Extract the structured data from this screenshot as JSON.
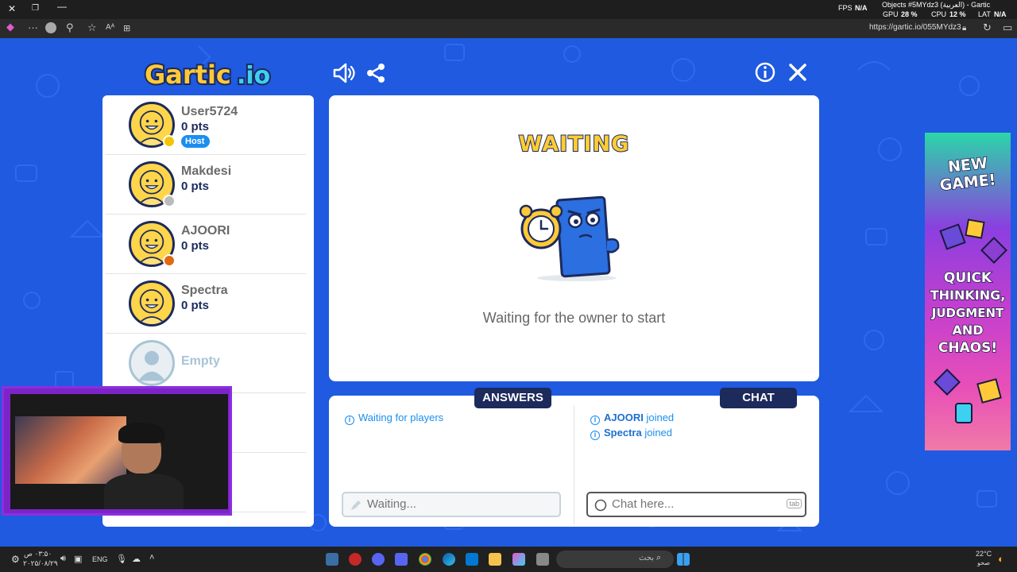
{
  "titlebar": {
    "fps_label": "FPS",
    "fps_value": "N/A",
    "gpu_label": "GPU",
    "gpu_value": "28 %",
    "cpu_label": "CPU",
    "cpu_value": "12 %",
    "lat_label": "LAT",
    "lat_value": "N/A",
    "tab_title": "Objects #5MYdz3 (العربية) - Gartic"
  },
  "browser": {
    "url": "https://gartic.io/055MYdz3"
  },
  "game": {
    "logo_text": "Gartic.io",
    "players": [
      {
        "name": "User5724",
        "pts": "0 pts",
        "host": true,
        "host_label": "Host",
        "dot": "#f5c400"
      },
      {
        "name": "Makdesi",
        "pts": "0 pts",
        "host": false,
        "dot": "#bbbbbb"
      },
      {
        "name": "AJOORI",
        "pts": "0 pts",
        "host": false,
        "dot": "#e06a10"
      },
      {
        "name": "Spectra",
        "pts": "0 pts",
        "host": false,
        "dot": ""
      },
      {
        "name": "Empty",
        "pts": "",
        "host": false,
        "dot": ""
      }
    ],
    "stage": {
      "title": "WAITING",
      "message": "Waiting for the owner to start"
    },
    "answers": {
      "header": "ANSWERS",
      "messages": [
        "Waiting for players"
      ],
      "input_placeholder": "Waiting..."
    },
    "chat": {
      "header": "CHAT",
      "messages": [
        {
          "name": "AJOORI",
          "text": " joined"
        },
        {
          "name": "Spectra",
          "text": " joined"
        }
      ],
      "input_placeholder": "Chat here...",
      "tab_hint": "tab"
    },
    "ad": {
      "line1": "NEW",
      "line2": "GAME!",
      "line3": "QUICK",
      "line4": "THINKING,",
      "line5": "JUDGMENT",
      "line6": "AND",
      "line7": "CHAOS!"
    }
  },
  "taskbar": {
    "time": "۰۳:۵۰ ص",
    "date": "۲۰۲۵/۰۸/۲۹",
    "lang": "ENG",
    "search_placeholder": "بحث",
    "temp": "22°C",
    "weather": "صحو"
  },
  "colors": {
    "game_bg": "#1f5ae0",
    "navy": "#1c2a5c",
    "accent_blue": "#1b8ef0",
    "waiting_yellow": "#ffcc33"
  }
}
